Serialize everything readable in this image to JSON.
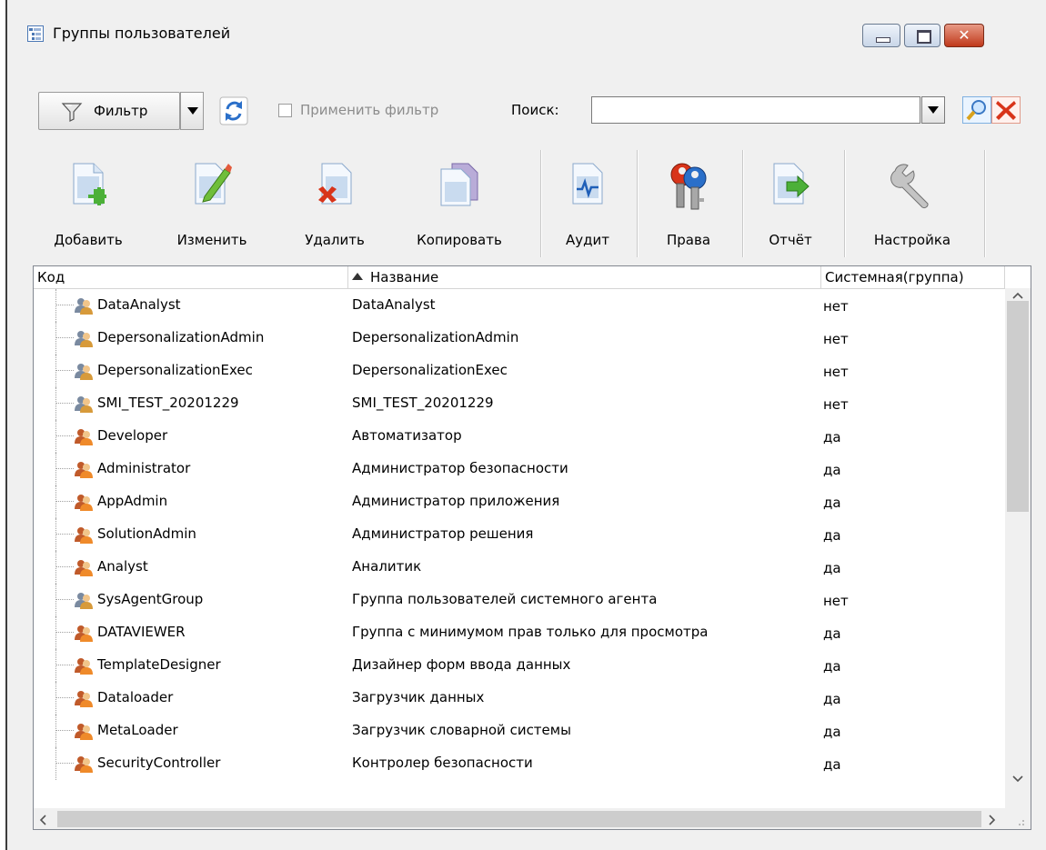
{
  "window": {
    "title": "Группы пользователей",
    "controls": {
      "minimize": "minimize",
      "maximize": "maximize",
      "close": "✕"
    }
  },
  "filter_bar": {
    "filter_label": "Фильтр",
    "apply_filter_label": "Применить фильтр",
    "apply_filter_checked": false,
    "search_label": "Поиск:",
    "search_value": ""
  },
  "toolbar": {
    "add": "Добавить",
    "edit": "Изменить",
    "delete": "Удалить",
    "copy": "Копировать",
    "audit": "Аудит",
    "rights": "Права",
    "report": "Отчёт",
    "settings": "Настройка"
  },
  "grid": {
    "columns": [
      "Код",
      "Название",
      "Системная(группа)"
    ],
    "sorted_column": "Название",
    "sort_direction": "asc",
    "rows": [
      {
        "code": "DataAnalyst",
        "name": "DataAnalyst",
        "system": "нет",
        "icon": "user-group-gray-icon"
      },
      {
        "code": "DepersonalizationAdmin",
        "name": "DepersonalizationAdmin",
        "system": "нет",
        "icon": "user-group-gray-icon"
      },
      {
        "code": "DepersonalizationExec",
        "name": "DepersonalizationExec",
        "system": "нет",
        "icon": "user-group-gray-icon"
      },
      {
        "code": "SMI_TEST_20201229",
        "name": "SMI_TEST_20201229",
        "system": "нет",
        "icon": "user-group-gray-icon"
      },
      {
        "code": "Developer",
        "name": "Автоматизатор",
        "system": "да",
        "icon": "user-group-orange-icon"
      },
      {
        "code": "Administrator",
        "name": "Администратор безопасности",
        "system": "да",
        "icon": "user-group-orange-icon"
      },
      {
        "code": "AppAdmin",
        "name": "Администратор приложения",
        "system": "да",
        "icon": "user-group-orange-icon"
      },
      {
        "code": "SolutionAdmin",
        "name": "Администратор решения",
        "system": "да",
        "icon": "user-group-orange-icon"
      },
      {
        "code": "Analyst",
        "name": "Аналитик",
        "system": "да",
        "icon": "user-group-orange-icon"
      },
      {
        "code": "SysAgentGroup",
        "name": "Группа пользователей системного агента",
        "system": "нет",
        "icon": "user-group-gray-icon"
      },
      {
        "code": "DATAVIEWER",
        "name": "Группа с минимумом прав только для просмотра",
        "system": "да",
        "icon": "user-group-orange-icon"
      },
      {
        "code": "TemplateDesigner",
        "name": "Дизайнер форм ввода данных",
        "system": "да",
        "icon": "user-group-orange-icon"
      },
      {
        "code": "Dataloader",
        "name": "Загрузчик данных",
        "system": "да",
        "icon": "user-group-orange-icon"
      },
      {
        "code": "MetaLoader",
        "name": "Загрузчик словарной системы",
        "system": "да",
        "icon": "user-group-orange-icon"
      },
      {
        "code": "SecurityController",
        "name": "Контролер безопасности",
        "system": "да",
        "icon": "user-group-orange-icon"
      }
    ]
  },
  "colors": {
    "accent": "#2a6fc9",
    "close_button": "#c0391b",
    "window_bg": "#f0f0f0"
  }
}
